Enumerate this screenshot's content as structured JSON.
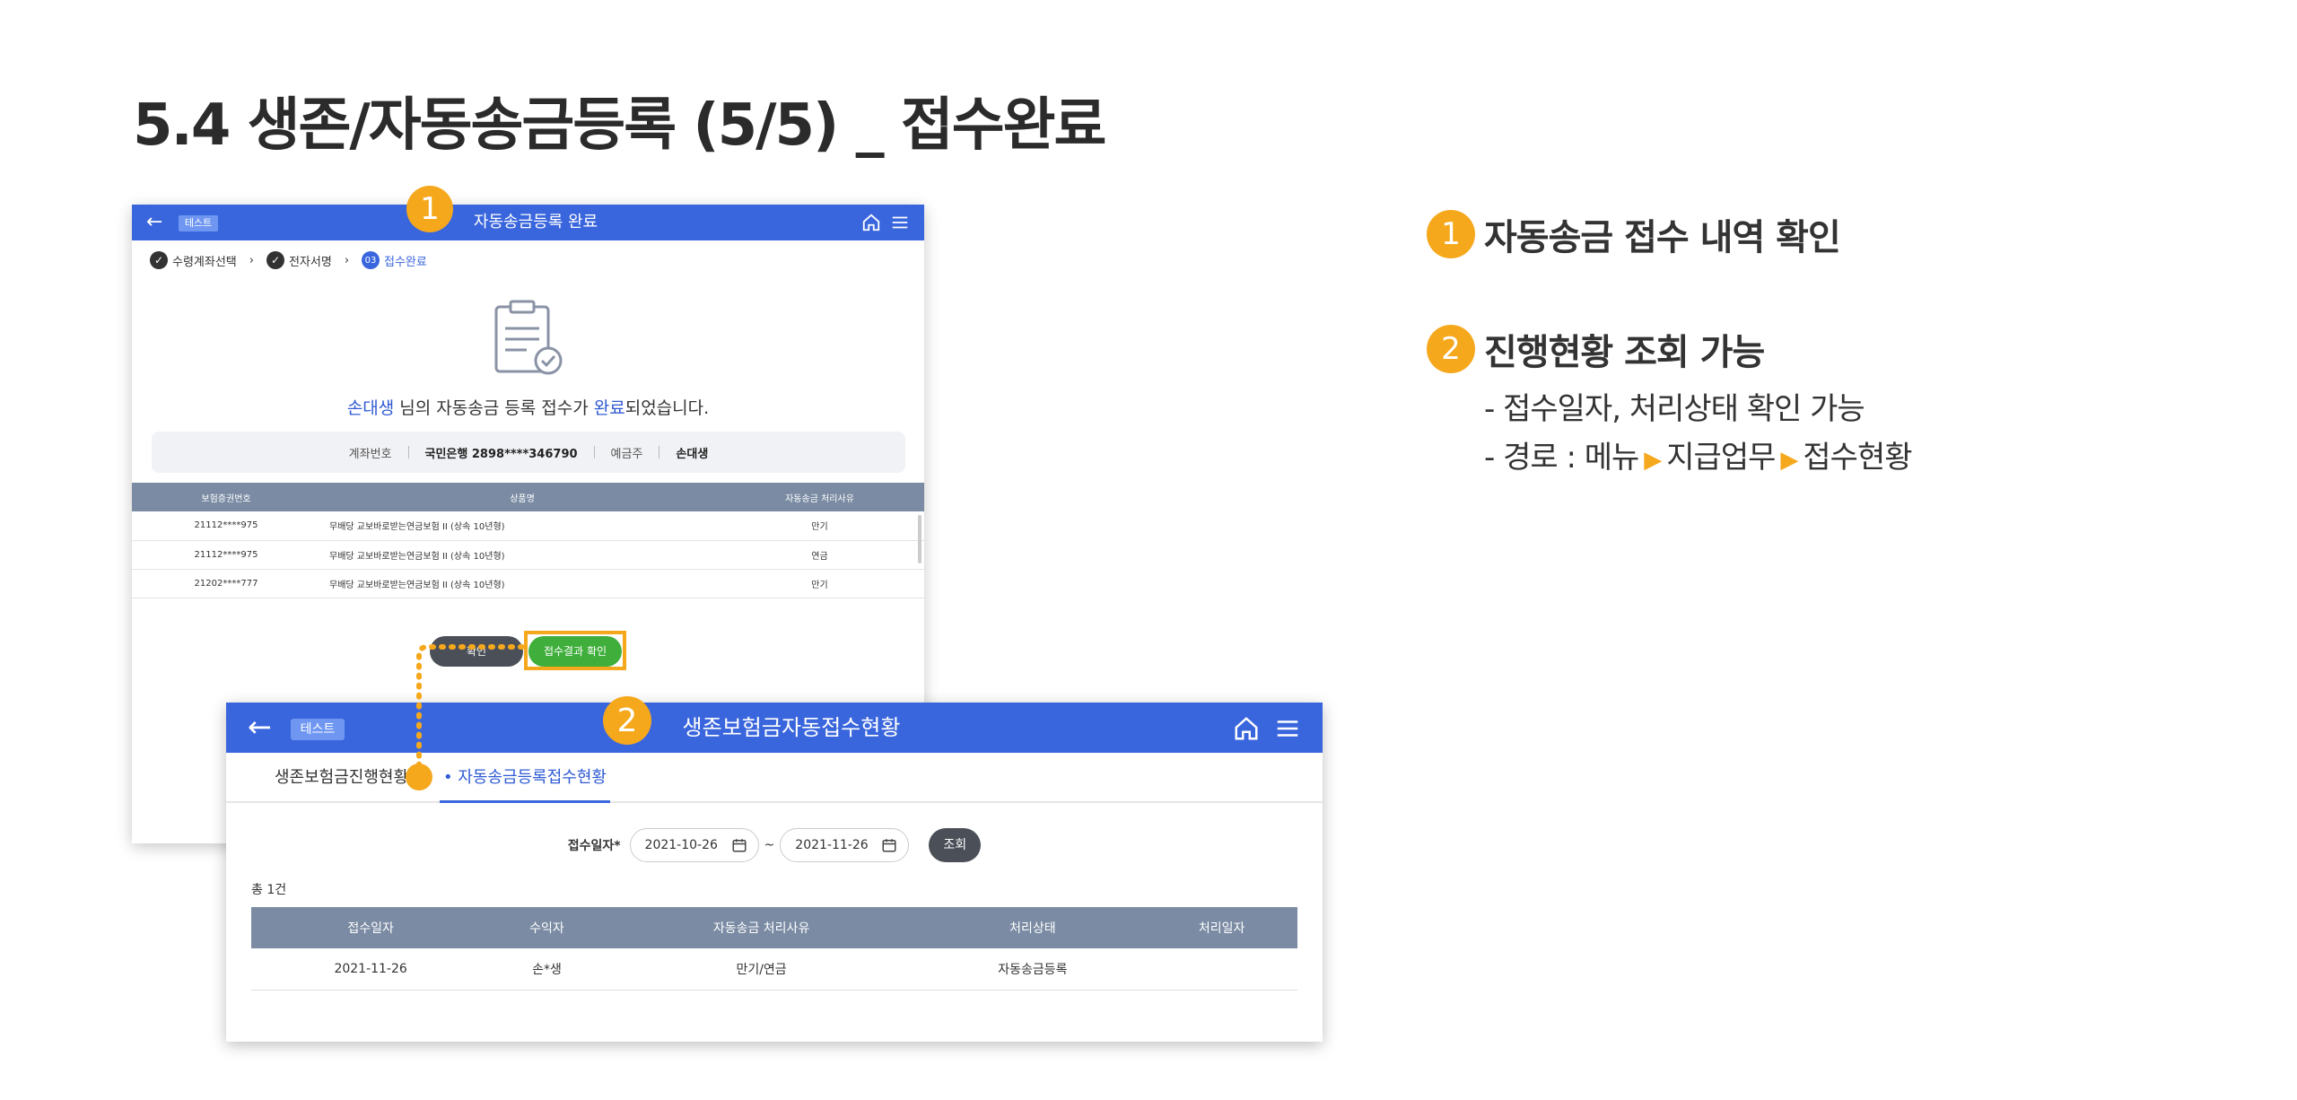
{
  "page": {
    "title": "5.4 생존/자동송금등록 (5/5) _ 접수완료"
  },
  "markers": {
    "m1": "1",
    "m2": "2"
  },
  "screen1": {
    "tag": "테스트",
    "title": "자동송금등록 완료",
    "steps": [
      {
        "label": "수령계좌선택"
      },
      {
        "label": "전자서명"
      },
      {
        "num": "03",
        "label": "접수완료"
      }
    ],
    "message": {
      "name": "손대생",
      "pre": " 님의 자동송금 등록 접수가 ",
      "hl": "완료",
      "post": "되었습니다."
    },
    "info": {
      "account_label": "계좌번호",
      "account_value": "국민은행 2898****346790",
      "holder_label": "예금주",
      "holder_value": "손대생"
    },
    "table": {
      "headers": [
        "보험증권번호",
        "상품명",
        "자동송금 처리사유"
      ],
      "rows": [
        [
          "21112****975",
          "무배당 교보바로받는연금보험 II (상속 10년형)",
          "만기"
        ],
        [
          "21112****975",
          "무배당 교보바로받는연금보험 II (상속 10년형)",
          "연금"
        ],
        [
          "21202****777",
          "무배당 교보바로받는연금보험 II (상속 10년형)",
          "만기"
        ]
      ]
    },
    "buttons": {
      "confirm": "확인",
      "result": "접수결과 확인"
    }
  },
  "screen2": {
    "tag": "테스트",
    "title": "생존보험금자동접수현황",
    "tabs": [
      "생존보험금진행현황",
      "자동송금등록접수현황"
    ],
    "search": {
      "label": "접수일자*",
      "from": "2021-10-26",
      "tilde": "~",
      "to": "2021-11-26",
      "button": "조회"
    },
    "count": "총 1건",
    "table": {
      "headers": [
        "접수일자",
        "수익자",
        "자동송금 처리사유",
        "처리상태",
        "처리일자"
      ],
      "rows": [
        [
          "2021-11-26",
          "손*생",
          "만기/연금",
          "자동송금등록",
          ""
        ]
      ]
    }
  },
  "notes": {
    "n1_num": "1",
    "n1_text": "자동송금 접수 내역 확인",
    "n2_num": "2",
    "n2_text": "진행현황 조회 가능",
    "sub1": "- 접수일자, 처리상태 확인 가능",
    "sub2_a": "- 경로 : 메뉴",
    "sub2_b": "지급업무",
    "sub2_c": "접수현황"
  },
  "colors": {
    "header_blue": "#3a66dd",
    "accent_orange": "#f5a81c",
    "table_header": "#7a8ba3",
    "green_button": "#3fae3b"
  },
  "icons": [
    "back-arrow-icon",
    "home-icon",
    "menu-icon",
    "check-circle-icon",
    "document-check-icon",
    "calendar-icon",
    "triangle-right-icon"
  ]
}
